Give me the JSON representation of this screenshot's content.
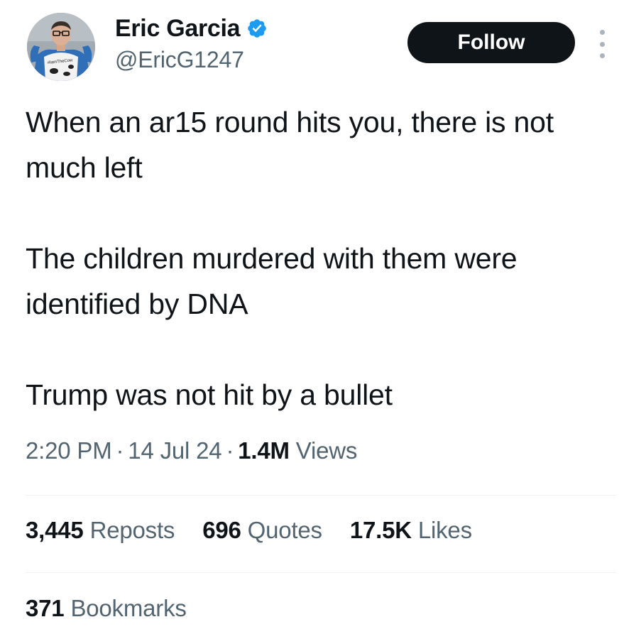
{
  "author": {
    "display_name": "Eric Garcia",
    "handle": "@EricG1247",
    "verified_icon": "verified-badge-icon",
    "avatar_shirt_text": "#IamTheCow"
  },
  "actions": {
    "follow_label": "Follow",
    "more_icon": "more-vertical-icon"
  },
  "tweet": {
    "paragraphs": [
      "When an ar15 round hits you, there is not much left",
      "The children murdered with them were identified by DNA",
      "Trump was not hit by a bullet"
    ]
  },
  "meta": {
    "time": "2:20 PM",
    "separator": "·",
    "date": "14 Jul 24",
    "views_count": "1.4M",
    "views_label": "Views"
  },
  "stats": {
    "reposts_count": "3,445",
    "reposts_label": "Reposts",
    "quotes_count": "696",
    "quotes_label": "Quotes",
    "likes_count": "17.5K",
    "likes_label": "Likes",
    "bookmarks_count": "371",
    "bookmarks_label": "Bookmarks"
  },
  "colors": {
    "text_primary": "#0f1419",
    "text_secondary": "#536471",
    "verified_blue": "#1d9bf0",
    "divider": "#eff3f4"
  }
}
